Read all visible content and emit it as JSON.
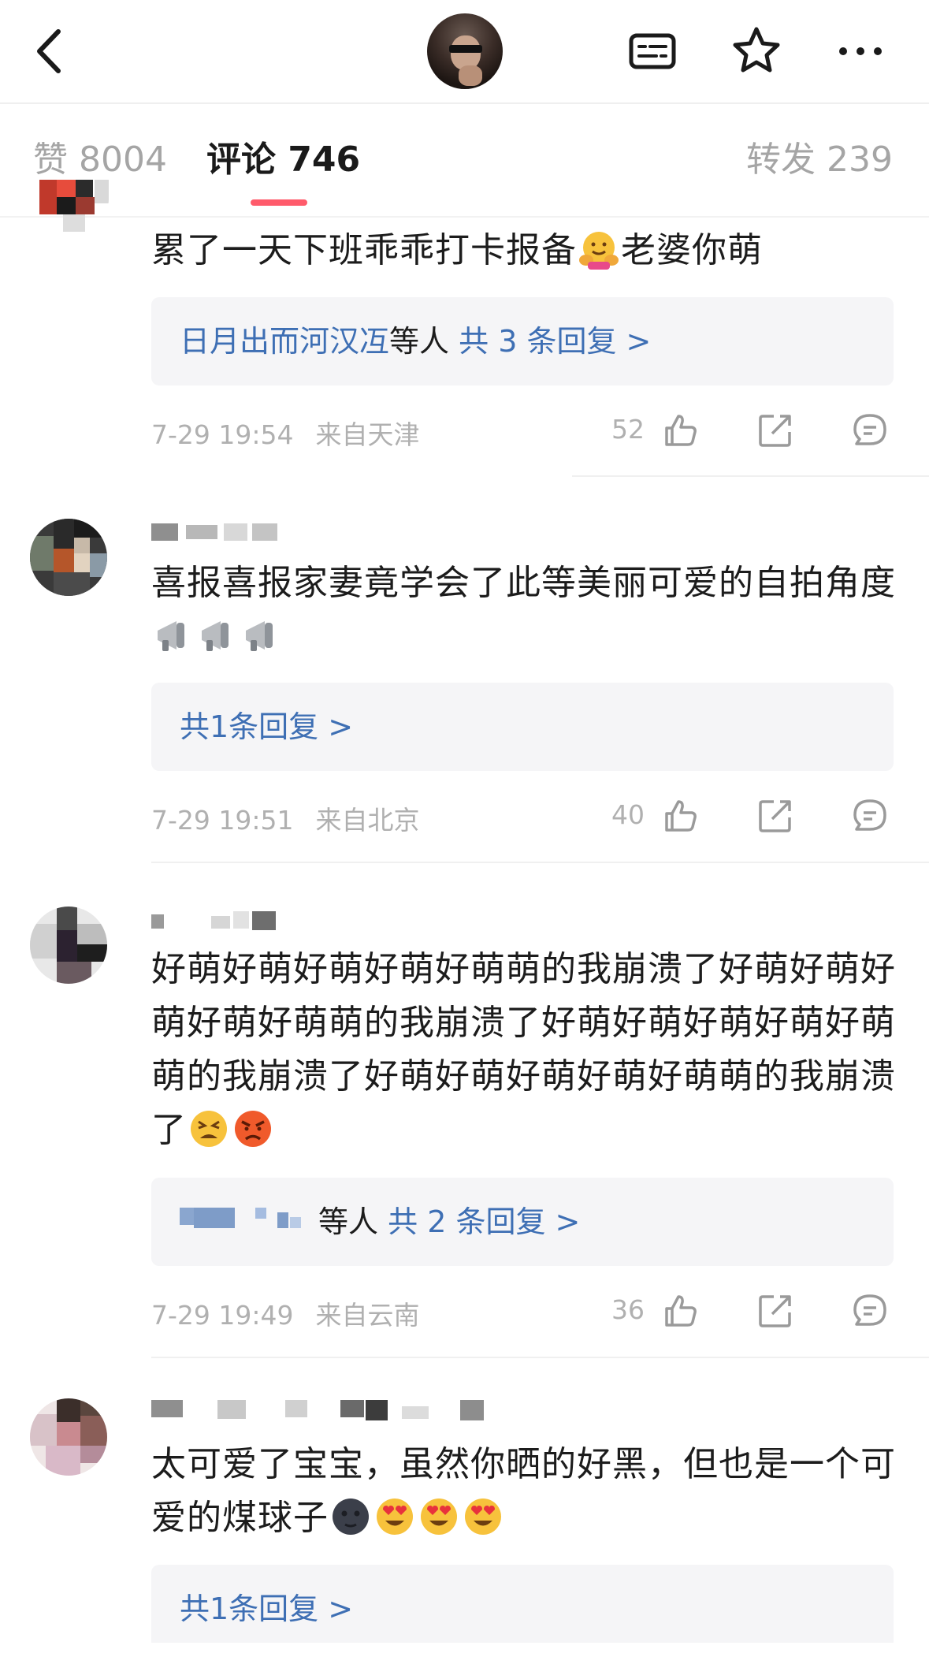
{
  "tabs": {
    "likes": "赞 8004",
    "comments": "评论 746",
    "reposts": "转发 239"
  },
  "icons": {
    "back": "back-chevron-icon",
    "subtitle": "caption-icon",
    "favorite": "star-icon",
    "more": "more-dots-icon",
    "like": "thumbs-up-icon",
    "share": "share-icon",
    "reply": "comment-bubble-icon"
  },
  "comments": [
    {
      "text": "累了一天下班乖乖打卡报备",
      "text_tail": "老婆你萌",
      "replies": {
        "names": "日月出而河汉冱",
        "suffix": "等人",
        "count": "共 3 条回复 >"
      },
      "time": "7-29 19:54",
      "location": "来自天津",
      "likes": "52"
    },
    {
      "text": "喜报喜报家妻竟学会了此等美丽可爱的自拍角度",
      "replies": {
        "count": "共1条回复 >"
      },
      "time": "7-29 19:51",
      "location": "来自北京",
      "likes": "40"
    },
    {
      "text": "好萌好萌好萌好萌好萌萌的我崩溃了好萌好萌好萌好萌好萌萌的我崩溃了好萌好萌好萌好萌好萌萌的我崩溃了好萌好萌好萌好萌好萌萌的我崩溃了",
      "replies": {
        "suffix": "等人",
        "count": "共 2 条回复 >"
      },
      "time": "7-29 19:49",
      "location": "来自云南",
      "likes": "36"
    },
    {
      "text": "太可爱了宝宝，虽然你晒的好黑，但也是一个可爱的煤球子",
      "replies": {
        "count": "共1条回复 >"
      }
    }
  ],
  "colors": {
    "accent_underline": "#ff5b6b",
    "link": "#3e6fb4",
    "muted": "#b0b0b0",
    "reply_bg": "#f5f5f7"
  }
}
